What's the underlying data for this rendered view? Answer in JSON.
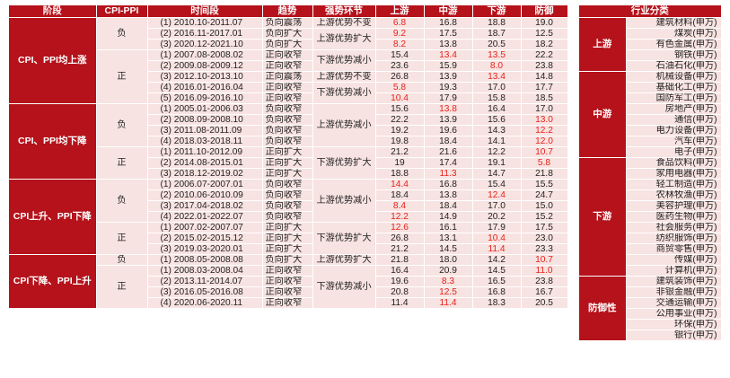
{
  "main": {
    "headers": [
      "阶段",
      "CPI-PPI",
      "时间段",
      "趋势",
      "强势环节",
      "上游",
      "中游",
      "下游",
      "防御"
    ],
    "stages": [
      {
        "label": "CPI、PPI均上涨",
        "signs": [
          {
            "label": "负",
            "groups": [
              {
                "strong": "上游优势不变",
                "rows": [
                  {
                    "period": "(1)  2010.10-2011.07",
                    "trend": "负向震荡",
                    "vals": [
                      "6.8",
                      "16.8",
                      "18.8",
                      "19.0"
                    ],
                    "red": [
                      0
                    ]
                  }
                ]
              },
              {
                "strong": "上游优势扩大",
                "rows": [
                  {
                    "period": "(2)  2016.11-2017.01",
                    "trend": "负向扩大",
                    "vals": [
                      "9.2",
                      "17.5",
                      "18.7",
                      "12.5"
                    ],
                    "red": [
                      0
                    ]
                  },
                  {
                    "period": "(3)  2020.12-2021.10",
                    "trend": "负向扩大",
                    "vals": [
                      "8.2",
                      "13.8",
                      "20.5",
                      "18.2"
                    ],
                    "red": [
                      0
                    ]
                  }
                ]
              }
            ]
          },
          {
            "label": "正",
            "groups": [
              {
                "strong": "下游优势减小",
                "rows": [
                  {
                    "period": "(1)  2007.08-2008.02",
                    "trend": "正向收窄",
                    "vals": [
                      "15.4",
                      "13.4",
                      "13.5",
                      "22.2"
                    ],
                    "red": [
                      1,
                      2
                    ]
                  },
                  {
                    "period": "(2)  2009.08-2009.12",
                    "trend": "正向收窄",
                    "vals": [
                      "23.6",
                      "15.9",
                      "8.0",
                      "23.8"
                    ],
                    "red": [
                      2
                    ]
                  }
                ]
              },
              {
                "strong": "上游优势不变",
                "rows": [
                  {
                    "period": "(3)  2012.10-2013.10",
                    "trend": "正向震荡",
                    "vals": [
                      "26.8",
                      "13.9",
                      "13.4",
                      "14.8"
                    ],
                    "red": [
                      2
                    ]
                  }
                ]
              },
              {
                "strong": "下游优势减小",
                "rows": [
                  {
                    "period": "(4)  2016.01-2016.04",
                    "trend": "正向收窄",
                    "vals": [
                      "5.8",
                      "19.3",
                      "17.0",
                      "17.7"
                    ],
                    "red": [
                      0
                    ]
                  },
                  {
                    "period": "(5)  2016.09-2016.10",
                    "trend": "正向收窄",
                    "vals": [
                      "10.4",
                      "17.9",
                      "15.8",
                      "18.5"
                    ],
                    "red": [
                      0
                    ]
                  }
                ]
              }
            ]
          }
        ]
      },
      {
        "label": "CPI、PPI均下降",
        "signs": [
          {
            "label": "负",
            "groups": [
              {
                "strong": "上游优势减小",
                "rows": [
                  {
                    "period": "(1)  2005.01-2006.03",
                    "trend": "负向收窄",
                    "vals": [
                      "15.6",
                      "13.8",
                      "16.4",
                      "17.0"
                    ],
                    "red": [
                      1
                    ]
                  },
                  {
                    "period": "(2)  2008.09-2008.10",
                    "trend": "负向收窄",
                    "vals": [
                      "22.2",
                      "13.9",
                      "15.6",
                      "13.0"
                    ],
                    "red": [
                      3
                    ]
                  },
                  {
                    "period": "(3)  2011.08-2011.09",
                    "trend": "负向收窄",
                    "vals": [
                      "19.2",
                      "19.6",
                      "14.3",
                      "12.2"
                    ],
                    "red": [
                      3
                    ]
                  },
                  {
                    "period": "(4)  2018.03-2018.11",
                    "trend": "负向收窄",
                    "vals": [
                      "19.8",
                      "18.4",
                      "14.1",
                      "12.0"
                    ],
                    "red": [
                      3
                    ]
                  }
                ]
              }
            ]
          },
          {
            "label": "正",
            "groups": [
              {
                "strong": "下游优势扩大",
                "rows": [
                  {
                    "period": "(1)  2011.10-2012.09",
                    "trend": "正向扩大",
                    "vals": [
                      "21.2",
                      "21.6",
                      "12.2",
                      "10.7"
                    ],
                    "red": [
                      3
                    ]
                  },
                  {
                    "period": "(2)  2014.08-2015.01",
                    "trend": "正向扩大",
                    "vals": [
                      "19",
                      "17.4",
                      "19.1",
                      "5.8"
                    ],
                    "red": [
                      3
                    ]
                  },
                  {
                    "period": "(3)  2018.12-2019.02",
                    "trend": "正向扩大",
                    "vals": [
                      "18.8",
                      "11.3",
                      "14.7",
                      "21.8"
                    ],
                    "red": [
                      1
                    ]
                  }
                ]
              }
            ]
          }
        ]
      },
      {
        "label": "CPI上升、PPI下降",
        "signs": [
          {
            "label": "负",
            "groups": [
              {
                "strong": "上游优势减小",
                "rows": [
                  {
                    "period": "(1)  2006.07-2007.01",
                    "trend": "负向收窄",
                    "vals": [
                      "14.4",
                      "16.8",
                      "15.4",
                      "15.5"
                    ],
                    "red": [
                      0
                    ]
                  },
                  {
                    "period": "(2)  2010.06-2010.09",
                    "trend": "负向收窄",
                    "vals": [
                      "18.4",
                      "13.8",
                      "12.4",
                      "24.7"
                    ],
                    "red": [
                      2
                    ]
                  },
                  {
                    "period": "(3)  2017.04-2018.02",
                    "trend": "负向收窄",
                    "vals": [
                      "8.4",
                      "18.4",
                      "17.0",
                      "15.0"
                    ],
                    "red": [
                      0
                    ]
                  },
                  {
                    "period": "(4)  2022.01-2022.07",
                    "trend": "负向收窄",
                    "vals": [
                      "12.2",
                      "14.9",
                      "20.2",
                      "15.2"
                    ],
                    "red": [
                      0
                    ]
                  }
                ]
              }
            ]
          },
          {
            "label": "正",
            "groups": [
              {
                "strong": "下游优势扩大",
                "rows": [
                  {
                    "period": "(1)  2007.02-2007.07",
                    "trend": "正向扩大",
                    "vals": [
                      "12.6",
                      "16.1",
                      "17.9",
                      "17.5"
                    ],
                    "red": [
                      0
                    ]
                  },
                  {
                    "period": "(2)  2015.02-2015.12",
                    "trend": "正向扩大",
                    "vals": [
                      "26.8",
                      "13.1",
                      "10.4",
                      "23.0"
                    ],
                    "red": [
                      2
                    ]
                  },
                  {
                    "period": "(3)  2019.03-2020.01",
                    "trend": "正向扩大",
                    "vals": [
                      "21.2",
                      "14.5",
                      "11.4",
                      "23.3"
                    ],
                    "red": [
                      2
                    ]
                  }
                ]
              }
            ]
          }
        ]
      },
      {
        "label": "CPI下降、PPI上升",
        "signs": [
          {
            "label": "负",
            "groups": [
              {
                "strong": "上游优势扩大",
                "rows": [
                  {
                    "period": "(1)  2008.05-2008.08",
                    "trend": "负向扩大",
                    "vals": [
                      "21.8",
                      "18.0",
                      "14.2",
                      "10.7"
                    ],
                    "red": [
                      3
                    ]
                  }
                ]
              }
            ]
          },
          {
            "label": "正",
            "groups": [
              {
                "strong": "下游优势减小",
                "rows": [
                  {
                    "period": "(1)  2008.03-2008.04",
                    "trend": "正向收窄",
                    "vals": [
                      "16.4",
                      "20.9",
                      "14.5",
                      "11.0"
                    ],
                    "red": [
                      3
                    ]
                  },
                  {
                    "period": "(2)  2013.11-2014.07",
                    "trend": "正向收窄",
                    "vals": [
                      "19.6",
                      "8.3",
                      "16.5",
                      "23.8"
                    ],
                    "red": [
                      1
                    ]
                  },
                  {
                    "period": "(3)  2016.05-2016.08",
                    "trend": "正向收窄",
                    "vals": [
                      "20.8",
                      "12.5",
                      "16.8",
                      "16.7"
                    ],
                    "red": [
                      1
                    ]
                  },
                  {
                    "period": "(4)  2020.06-2020.11",
                    "trend": "正向收窄",
                    "vals": [
                      "11.4",
                      "11.4",
                      "18.3",
                      "20.5"
                    ],
                    "red": [
                      1
                    ]
                  }
                ]
              }
            ]
          }
        ]
      }
    ]
  },
  "industry": {
    "header": "行业分类",
    "categories": [
      {
        "label": "上游",
        "items": [
          "建筑材料(申万)",
          "煤炭(申万)",
          "有色金属(申万)",
          "钢铁(申万)",
          "石油石化(申万)"
        ]
      },
      {
        "label": "中游",
        "items": [
          "机械设备(申万)",
          "基础化工(申万)",
          "国防军工(申万)",
          "房地产(申万)",
          "通信(申万)",
          "电力设备(申万)",
          "汽车(申万)",
          "电子(申万)"
        ]
      },
      {
        "label": "下游",
        "items": [
          "食品饮料(申万)",
          "家用电器(申万)",
          "轻工制造(申万)",
          "农林牧渔(申万)",
          "美容护理(申万)",
          "医药生物(申万)",
          "社会服务(申万)",
          "纺织服饰(申万)",
          "商贸零售(申万)",
          "传媒(申万)",
          "计算机(申万)"
        ]
      },
      {
        "label": "防御性",
        "items": [
          "建筑装饰(申万)",
          "非银金融(申万)",
          "交通运输(申万)",
          "公用事业(申万)",
          "环保(申万)",
          "银行(申万)"
        ]
      }
    ]
  },
  "colors": {
    "accent": "#b5121b",
    "cell_bg": "#f7e3e1",
    "highlight": "#e8211a"
  }
}
